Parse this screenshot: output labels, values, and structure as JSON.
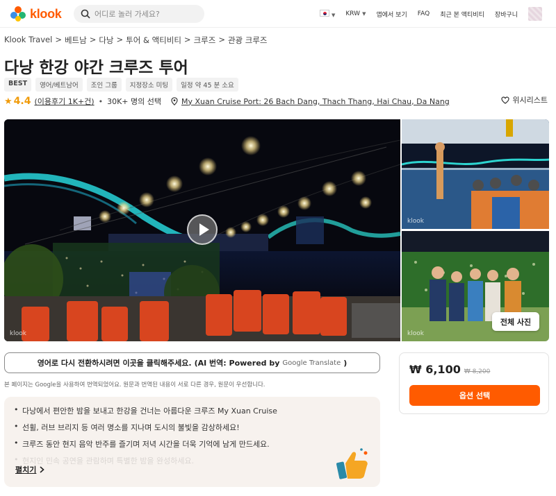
{
  "header": {
    "logo_text": "klook",
    "search_placeholder": "어디로 놀러 가세요?",
    "currency": "KRW",
    "nav_app": "앱에서 보기",
    "nav_faq": "FAQ",
    "nav_recent": "최근 본 액티비티",
    "nav_cart": "장바구니"
  },
  "breadcrumb": {
    "items": [
      "Klook Travel",
      "베트남",
      "다낭",
      "투어 & 액티비티",
      "크루즈",
      "관광 크루즈"
    ],
    "separator": ">"
  },
  "title": "다낭 한강 야간 크루즈 투어",
  "tags": [
    "BEST",
    "영어/베트남어",
    "조인 그룹",
    "지정장소 미팅",
    "일정 약 45 분 소요"
  ],
  "rating": {
    "score": "4.4",
    "reviews": "(이용후기 1K+건)",
    "booked": "30K+ 명의 선택",
    "location": "My Xuan Cruise Port: 26 Bach Dang, Thach Thang, Hai Chau, Da Nang",
    "wishlist": "위시리스트"
  },
  "gallery": {
    "watermark": "klook",
    "all_photos": "전체 사진"
  },
  "translate": {
    "text": "영어로 다시 전환하시려면 이곳을 클릭해주세요.",
    "ai_label": "(AI 번역: Powered by",
    "google": "Google Translate",
    "close_paren": ")",
    "note": "본 페이지는 Google을 사용하여 번역되었어요. 원문과 번역된 내용이 서로 다른 경우, 원문이 우선합니다."
  },
  "highlights": {
    "items": [
      "다낭에서 편안한 밤을 보내고 한강을 건너는 아름다운 크루즈 My Xuan Cruise",
      "선휠, 러브 브리지 등 여러 명소를 지나며 도시의 불빛을 감상하세요!",
      "크루즈 동안 현지 음악 반주를 즐기며 저녁 시간을 더욱 기억에 남게 만드세요.",
      "현지인 민속 공연을 관람하며 특별한 밤을 완성하세요."
    ],
    "expand_label": "펼치기"
  },
  "price": {
    "current": "₩ 6,100",
    "original": "₩ 8,200",
    "button": "옵션 선택"
  },
  "colors": {
    "brand": "#ff5b00",
    "rating": "#f09b0a"
  }
}
